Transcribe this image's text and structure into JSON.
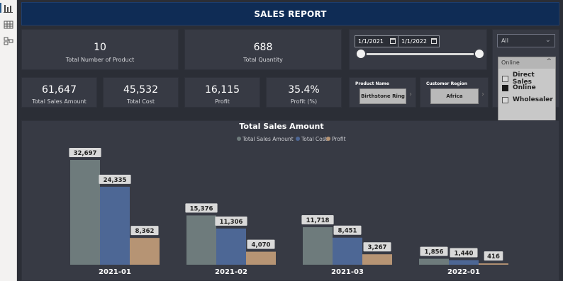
{
  "header": {
    "title": "SALES REPORT"
  },
  "kpis": {
    "total_products": {
      "value": "10",
      "label": "Total Number of Product"
    },
    "total_quantity": {
      "value": "688",
      "label": "Total Quantity"
    },
    "total_sales": {
      "value": "61,647",
      "label": "Total Sales Amount"
    },
    "total_cost": {
      "value": "45,532",
      "label": "Total Cost"
    },
    "profit": {
      "value": "16,115",
      "label": "Profit"
    },
    "profit_pct": {
      "value": "35.4%",
      "label": "Profit (%)"
    }
  },
  "date_filter": {
    "start": "1/1/2021",
    "end": "1/1/2022"
  },
  "slicers": {
    "product": {
      "header": "Product Name",
      "value": "Birthstone Ring"
    },
    "region": {
      "header": "Customer Region",
      "value": "Africa"
    }
  },
  "dropdowns": {
    "first": "All",
    "channel": "Online"
  },
  "channel_options": [
    {
      "label": "Direct Sales",
      "checked": false
    },
    {
      "label": "Online",
      "checked": true
    },
    {
      "label": "Wholesaler",
      "checked": false
    }
  ],
  "colors": {
    "sales": "#6e7b7c",
    "cost": "#4d6795",
    "profit": "#b69474"
  },
  "chart_data": {
    "type": "bar",
    "title": "Total Sales Amount",
    "categories": [
      "2021-01",
      "2021-02",
      "2021-03",
      "2022-01"
    ],
    "series": [
      {
        "name": "Total Sales Amount",
        "values": [
          32697,
          15376,
          11718,
          1856
        ],
        "labels": [
          "32,697",
          "15,376",
          "11,718",
          "1,856"
        ]
      },
      {
        "name": "Total Cost",
        "values": [
          24335,
          11306,
          8451,
          1440
        ],
        "labels": [
          "24,335",
          "11,306",
          "8,451",
          "1,440"
        ]
      },
      {
        "name": "Profit",
        "values": [
          8362,
          4070,
          3267,
          416
        ],
        "labels": [
          "8,362",
          "4,070",
          "3,267",
          "416"
        ]
      }
    ],
    "legend_position": "top-center",
    "grid": false
  }
}
